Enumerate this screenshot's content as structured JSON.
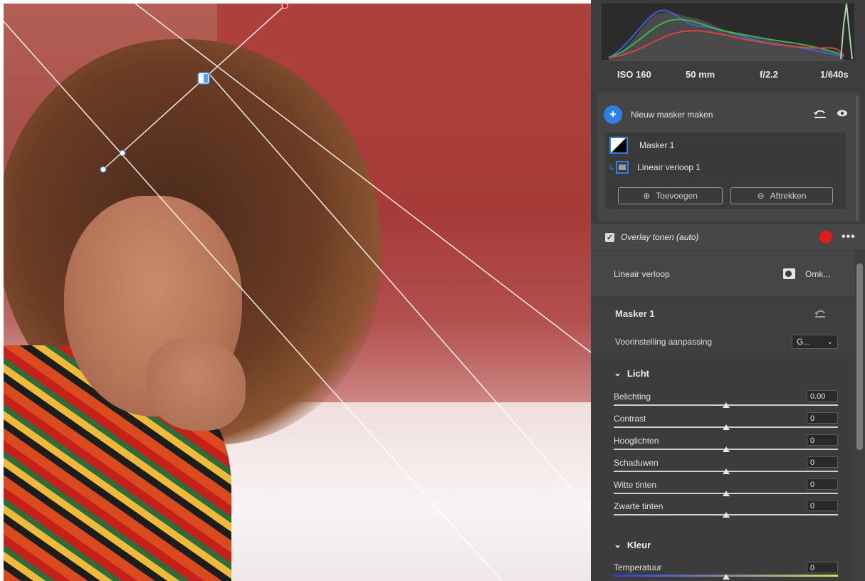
{
  "colors": {
    "accent": "#2f7fe8",
    "overlay": "#e31b1b",
    "panel_bg": "#3d3d3d"
  },
  "histogram": {
    "iso": "ISO 160",
    "focal": "50 mm",
    "aperture": "f/2.2",
    "shutter": "1/640s"
  },
  "masks": {
    "new_mask_label": "Nieuw masker maken",
    "mask1_label": "Masker 1",
    "sub_label": "Lineair verloop 1",
    "add_label": "Toevoegen",
    "subtract_label": "Aftrekken"
  },
  "overlay": {
    "label": "Overlay tonen (auto)",
    "checked": true
  },
  "tool": {
    "label": "Lineair verloop",
    "invert_label": "Omk..."
  },
  "mask_settings": {
    "title": "Masker 1",
    "preset_label": "Voorinstelling aanpassing",
    "preset_value": "G..."
  },
  "light": {
    "title": "Licht",
    "sliders": [
      {
        "label": "Belichting",
        "value": "0.00"
      },
      {
        "label": "Contrast",
        "value": "0"
      },
      {
        "label": "Hooglichten",
        "value": "0"
      },
      {
        "label": "Schaduwen",
        "value": "0"
      },
      {
        "label": "Witte tinten",
        "value": "0"
      },
      {
        "label": "Zwarte tinten",
        "value": "0"
      }
    ]
  },
  "color": {
    "title": "Kleur",
    "sliders": [
      {
        "label": "Temperatuur",
        "value": "0"
      }
    ]
  }
}
